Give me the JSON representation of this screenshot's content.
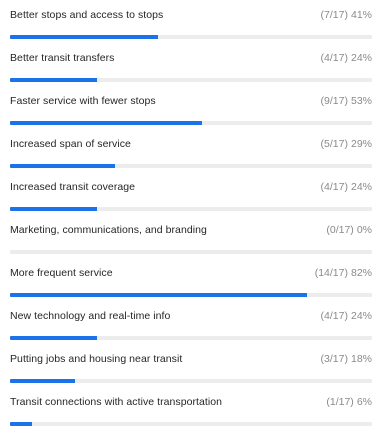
{
  "results": [
    {
      "label": "Better stops and access to stops",
      "count_text": "(7/17)",
      "percent_text": "41%",
      "fraction": 0.41
    },
    {
      "label": "Better transit transfers",
      "count_text": "(4/17)",
      "percent_text": "24%",
      "fraction": 0.24
    },
    {
      "label": "Faster service with fewer stops",
      "count_text": "(9/17)",
      "percent_text": "53%",
      "fraction": 0.53
    },
    {
      "label": "Increased span of service",
      "count_text": "(5/17)",
      "percent_text": "29%",
      "fraction": 0.29
    },
    {
      "label": "Increased transit coverage",
      "count_text": "(4/17)",
      "percent_text": "24%",
      "fraction": 0.24
    },
    {
      "label": "Marketing, communications, and branding",
      "count_text": "(0/17)",
      "percent_text": "0%",
      "fraction": 0.0
    },
    {
      "label": "More frequent service",
      "count_text": "(14/17)",
      "percent_text": "82%",
      "fraction": 0.82
    },
    {
      "label": "New technology and real-time info",
      "count_text": "(4/17)",
      "percent_text": "24%",
      "fraction": 0.24
    },
    {
      "label": "Putting jobs and housing near transit",
      "count_text": "(3/17)",
      "percent_text": "18%",
      "fraction": 0.18
    },
    {
      "label": "Transit connections with active transportation",
      "count_text": "(1/17)",
      "percent_text": "6%",
      "fraction": 0.06
    }
  ],
  "colors": {
    "bar_fill": "#1a73e8",
    "bar_track": "#ececec",
    "label_text": "#262626",
    "stats_text": "#8a8a8a"
  }
}
